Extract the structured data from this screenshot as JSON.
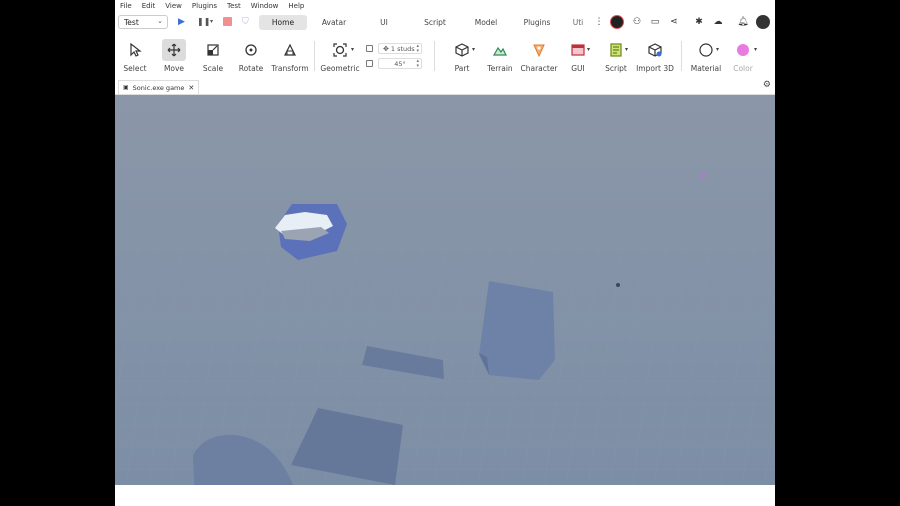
{
  "menu": [
    "File",
    "Edit",
    "View",
    "Plugins",
    "Test",
    "Window",
    "Help"
  ],
  "mode_select": {
    "value": "Test"
  },
  "ribbon_tabs": [
    {
      "label": "Home",
      "active": true
    },
    {
      "label": "Avatar",
      "active": false
    },
    {
      "label": "UI",
      "active": false
    },
    {
      "label": "Script",
      "active": false
    },
    {
      "label": "Model",
      "active": false
    },
    {
      "label": "Plugins",
      "active": false
    },
    {
      "label": "Uti",
      "active": false
    }
  ],
  "tools": {
    "select": "Select",
    "move": "Move",
    "scale": "Scale",
    "rotate": "Rotate",
    "transform": "Transform",
    "geometric": "Geometric",
    "part": "Part",
    "terrain": "Terrain",
    "character": "Character",
    "gui": "GUI",
    "script": "Script",
    "import3d": "Import 3D",
    "material": "Material",
    "color": "Color"
  },
  "snap": {
    "move_value": "1 studs",
    "rotate_value": "45°"
  },
  "document_tab": {
    "title": "Sonic.exe game"
  },
  "colors": {
    "accent_blue": "#3a6fd8",
    "color_swatch": "#e87be0",
    "viewport_sky": "#8996a8",
    "viewport_ground": "#7a8ca4"
  }
}
